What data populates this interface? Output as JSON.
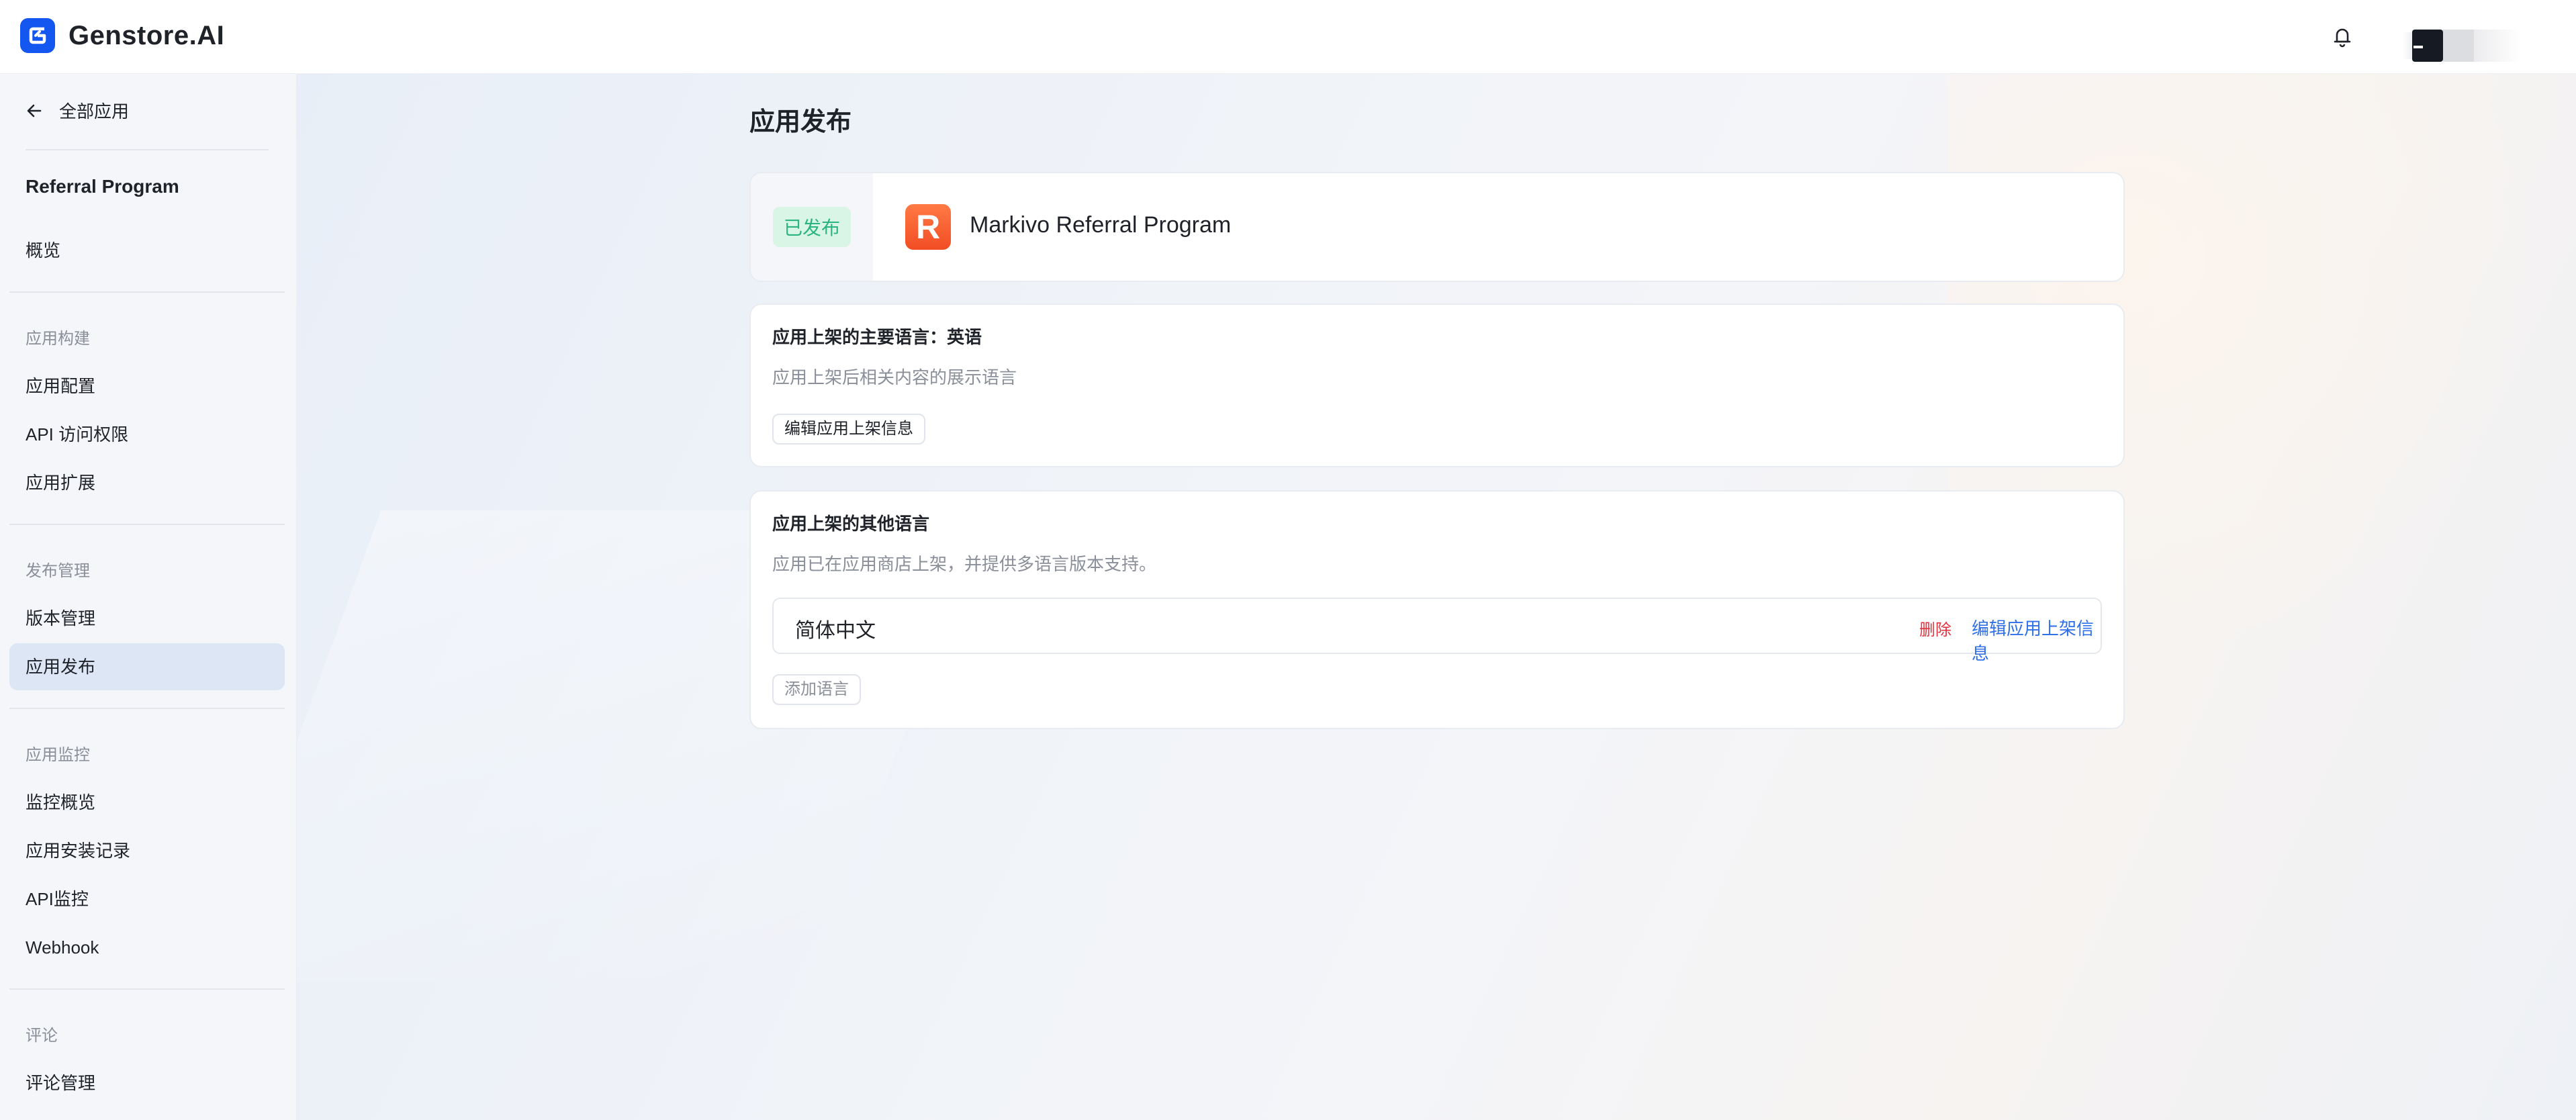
{
  "header": {
    "logo_text": "Genstore.AI",
    "notification_icon": "bell-icon"
  },
  "sidebar": {
    "back_label": "全部应用",
    "app_name": "Referral Program",
    "overview": "概览",
    "groups": [
      {
        "title": "应用构建",
        "items": [
          "应用配置",
          "API 访问权限",
          "应用扩展"
        ]
      },
      {
        "title": "发布管理",
        "items": [
          "版本管理",
          "应用发布"
        ]
      },
      {
        "title": "应用监控",
        "items": [
          "监控概览",
          "应用安装记录",
          "API监控",
          "Webhook"
        ]
      },
      {
        "title": "评论",
        "items": [
          "评论管理"
        ]
      }
    ],
    "active_item": "应用发布"
  },
  "main": {
    "page_title": "应用发布",
    "app_card": {
      "status": "已发布",
      "status_color": "#2ab57c",
      "icon_letter": "R",
      "icon_color": "#f5572a",
      "app_title": "Markivo Referral Program"
    },
    "primary_language": {
      "heading": "应用上架的主要语言：英语",
      "description": "应用上架后相关内容的展示语言",
      "edit_button": "编辑应用上架信息"
    },
    "other_languages": {
      "heading": "应用上架的其他语言",
      "description": "应用已在应用商店上架，并提供多语言版本支持。",
      "languages": [
        {
          "name": "简体中文",
          "delete_label": "删除",
          "edit_label": "编辑应用上架信息"
        }
      ],
      "add_button": "添加语言"
    }
  }
}
